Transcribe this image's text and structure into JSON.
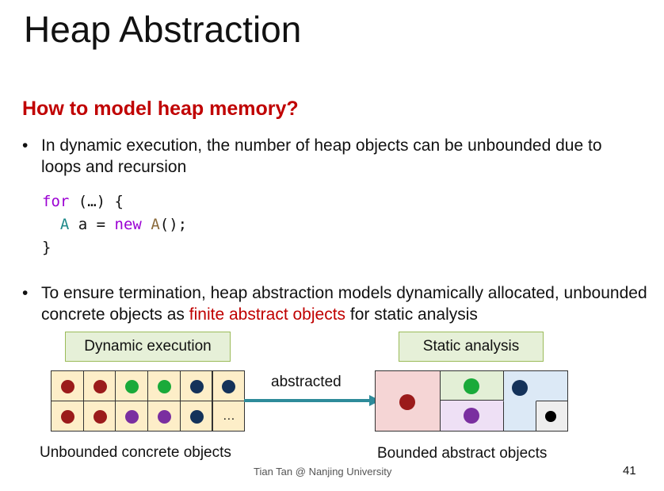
{
  "title": "Heap Abstraction",
  "subtitle": "How to model heap memory?",
  "bullets": {
    "b1_dot": "•",
    "b1_text": "In dynamic execution, the number of heap objects can be unbounded due to loops and recursion",
    "b2_dot": "•",
    "b2_pre": "To ensure termination, heap abstraction models dynamically allocated, unbounded concrete objects as ",
    "b2_highlight": "finite abstract objects",
    "b2_post": " for static analysis"
  },
  "code": {
    "l1_kw": "for",
    "l1_rest": " (…) {",
    "l2_type": "A",
    "l2_var": " a = ",
    "l2_kw": "new",
    "l2_ctor": " A",
    "l2_end": "();",
    "l3": "}"
  },
  "diagram": {
    "dynamic_label": "Dynamic execution",
    "static_label": "Static analysis",
    "arrow_label": "abstracted",
    "ellipsis": "…",
    "caption_left": "Unbounded concrete objects",
    "caption_right": "Bounded abstract objects",
    "colors": {
      "red": "#9b1b1b",
      "green": "#1aaa3a",
      "navy": "#14325a",
      "purple": "#7a2fa0",
      "black": "#000000",
      "cell_fill": "#fdeec8",
      "arrow": "#2e8b9a",
      "region_red": "#f5d5d5",
      "region_green": "#e3efd6",
      "region_purple": "#eee0f5",
      "region_blue": "#dce9f6",
      "region_gray": "#eeeeee"
    },
    "grid_rows": [
      [
        "red",
        "red",
        "green",
        "green",
        "navy",
        "navy"
      ],
      [
        "red",
        "red",
        "purple",
        "purple",
        "navy",
        "ellipsis"
      ]
    ]
  },
  "footer": "Tian Tan @ Nanjing University",
  "page_number": "41"
}
